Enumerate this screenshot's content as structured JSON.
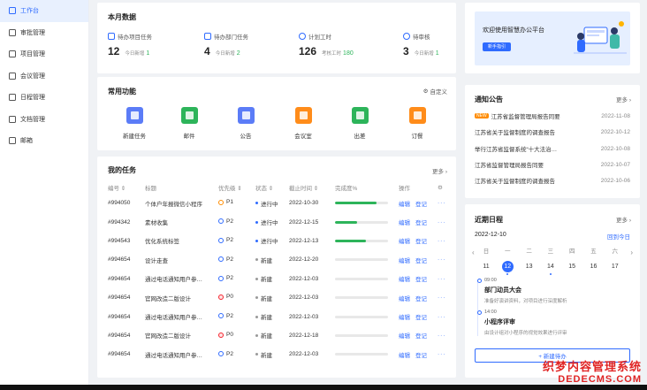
{
  "sidebar": {
    "items": [
      {
        "label": "工作台",
        "active": true
      },
      {
        "label": "审批管理"
      },
      {
        "label": "项目管理"
      },
      {
        "label": "会议管理"
      },
      {
        "label": "日程管理"
      },
      {
        "label": "文档管理"
      },
      {
        "label": "邮箱"
      }
    ]
  },
  "monthly": {
    "title": "本月数据",
    "stats": [
      {
        "label": "待办项目任务",
        "value": "12",
        "sub": "今日新增",
        "delta": "1"
      },
      {
        "label": "待办部门任务",
        "value": "4",
        "sub": "今日新增",
        "delta": "2"
      },
      {
        "label": "计划工时",
        "value": "126",
        "sub": "考核工时",
        "delta": "180"
      },
      {
        "label": "待审核",
        "value": "3",
        "sub": "今日新增",
        "delta": "1"
      }
    ]
  },
  "banner": {
    "text": "欢迎使用智慧办公平台",
    "button": "新手指引"
  },
  "functions": {
    "title": "常用功能",
    "customize": "自定义",
    "items": [
      {
        "label": "新建任务",
        "color": "#5b7cf7"
      },
      {
        "label": "邮件",
        "color": "#2db45a"
      },
      {
        "label": "公告",
        "color": "#5b7cf7"
      },
      {
        "label": "会议室",
        "color": "#ff8c1a"
      },
      {
        "label": "出差",
        "color": "#2db45a"
      },
      {
        "label": "订餐",
        "color": "#ff8c1a"
      }
    ]
  },
  "notices": {
    "title": "通知公告",
    "more": "更多 ›",
    "badge": "NEW",
    "items": [
      {
        "text": "江苏省监督管理局报告同要",
        "date": "2022-11-08",
        "new": true
      },
      {
        "text": "江苏省关于监督制度的调查报告",
        "date": "2022-10-12"
      },
      {
        "text": "举行江苏省监督系统“十大法治…",
        "date": "2022-10-08"
      },
      {
        "text": "江苏省监督管理局报告同要",
        "date": "2022-10-07"
      },
      {
        "text": "江苏省关于监督制度的调查报告",
        "date": "2022-10-06"
      }
    ]
  },
  "tasks": {
    "title": "我的任务",
    "more": "更多 ›",
    "headers": [
      "编号 ⇕",
      "标题",
      "优先级 ⇕",
      "状态 ⇕",
      "截止时间 ⇕",
      "完成度%",
      "操作"
    ],
    "edit": "编辑",
    "log": "登记",
    "rows": [
      {
        "id": "#994050",
        "title": "个体户年报微信小程序",
        "priority": "P1",
        "status": "进行中",
        "due": "2022-10-30",
        "progress": 0.78
      },
      {
        "id": "#994342",
        "title": "素材收集",
        "priority": "P2",
        "status": "进行中",
        "due": "2022-12-15",
        "progress": 0.42
      },
      {
        "id": "#994543",
        "title": "优化系统标签",
        "priority": "P2",
        "status": "进行中",
        "due": "2022-12-13",
        "progress": 0.58
      },
      {
        "id": "#994654",
        "title": "设计走查",
        "priority": "P2",
        "status": "新建",
        "due": "2022-12-20",
        "progress": 0
      },
      {
        "id": "#994654",
        "title": "通过电话通知用户参…",
        "priority": "P2",
        "status": "新建",
        "due": "2022-12-03",
        "progress": 0
      },
      {
        "id": "#994654",
        "title": "官网改造二版设计",
        "priority": "P0",
        "status": "新建",
        "due": "2022-12-03",
        "progress": 0
      },
      {
        "id": "#994654",
        "title": "通过电话通知用户参…",
        "priority": "P2",
        "status": "新建",
        "due": "2022-12-03",
        "progress": 0
      },
      {
        "id": "#994654",
        "title": "官网改造二版设计",
        "priority": "P0",
        "status": "新建",
        "due": "2022-12-18",
        "progress": 0
      },
      {
        "id": "#994654",
        "title": "通过电话通知用户参…",
        "priority": "P2",
        "status": "新建",
        "due": "2022-12-03",
        "progress": 0
      }
    ]
  },
  "schedule": {
    "title": "近期日程",
    "more": "更多 ›",
    "date": "2022-12-10",
    "today": "回到今日",
    "days": [
      {
        "wd": "日",
        "d": "11"
      },
      {
        "wd": "一",
        "d": "12",
        "selected": true,
        "dot": true
      },
      {
        "wd": "二",
        "d": "13"
      },
      {
        "wd": "三",
        "d": "14",
        "dot": true
      },
      {
        "wd": "四",
        "d": "15"
      },
      {
        "wd": "五",
        "d": "16"
      },
      {
        "wd": "六",
        "d": "17"
      }
    ],
    "events": [
      {
        "time": "09:00",
        "title": "部门动员大会",
        "desc": "准备好演讲资料，对项目进行深度解析"
      },
      {
        "time": "14:00",
        "title": "小程序评审",
        "desc": "由设计组对小程序的视觉效果进行评审"
      }
    ],
    "add": "+ 新建待办"
  },
  "watermark": {
    "line1": "织梦内容管理系统",
    "line2": "DEDECMS.COM"
  }
}
